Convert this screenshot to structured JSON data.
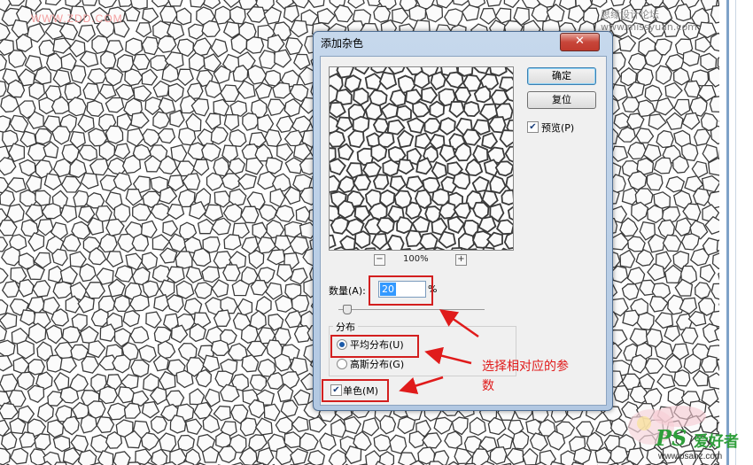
{
  "watermarks": {
    "top_left": "WWW.ZDD.COM",
    "top_right": "思缘设计论坛 www.missyuan.com",
    "brand_ps": "PS",
    "brand_cn": "爱好者",
    "brand_url": "www.psahz.com"
  },
  "dialog": {
    "title": "添加杂色",
    "close_glyph": "✕",
    "ok_label": "确定",
    "reset_label": "复位",
    "preview_label": "预览(P)",
    "preview_checked": true,
    "zoom": {
      "minus": "−",
      "value": "100%",
      "plus": "+"
    },
    "amount_label": "数量(A):",
    "amount_value": "20",
    "amount_unit": "%",
    "amount_slider_fraction": 0.05,
    "distribution": {
      "legend": "分布",
      "uniform_label": "平均分布(U)",
      "gaussian_label": "高斯分布(G)",
      "selected": "uniform"
    },
    "monochrome_label": "单色(M)",
    "monochrome_checked": true,
    "check_glyph": "✔"
  },
  "annotation": {
    "line1": "选择相对应的参",
    "line2": "数",
    "color": "#e01b1b"
  }
}
